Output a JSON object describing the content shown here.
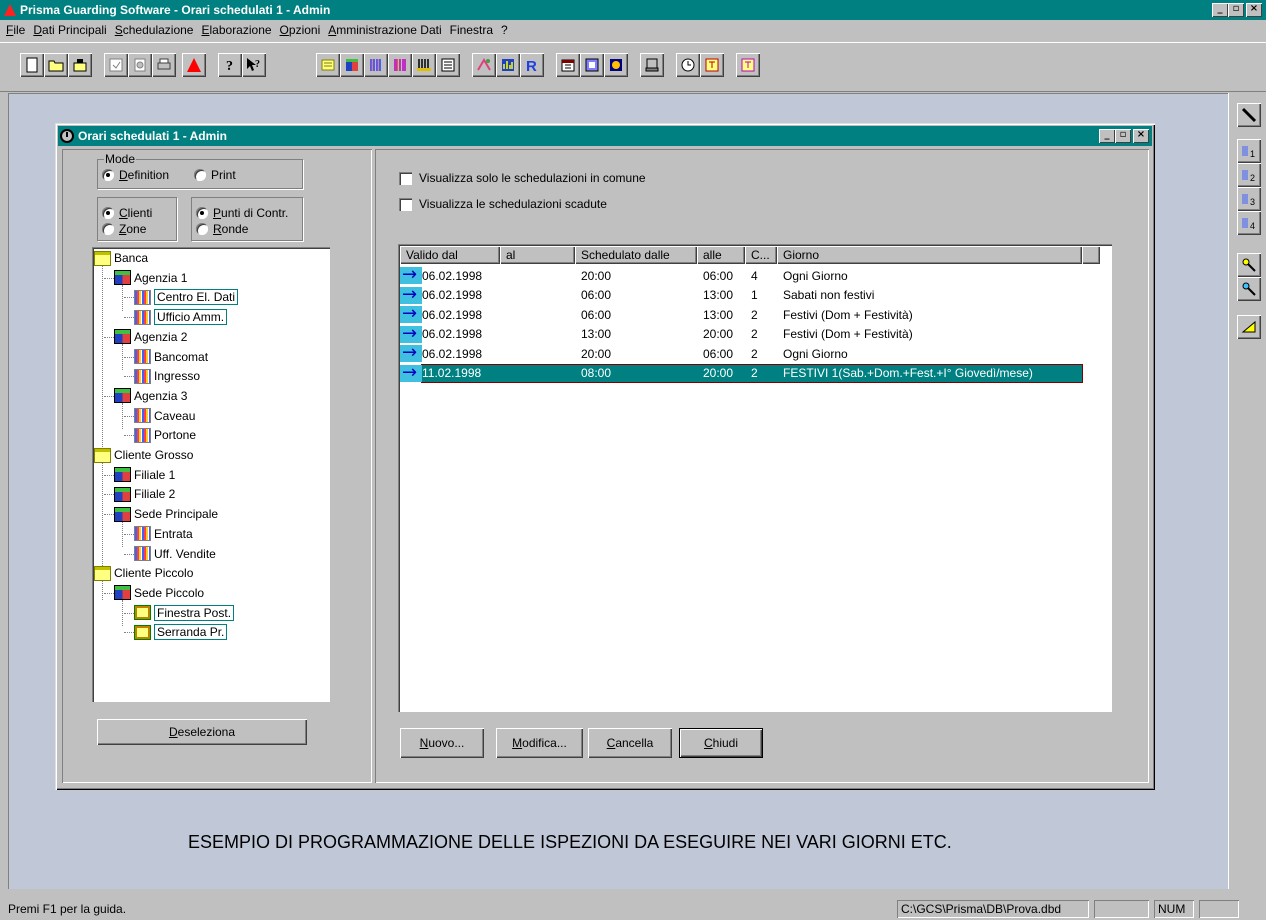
{
  "app": {
    "title": "Prisma Guarding Software - Orari schedulati 1 - Admin",
    "window_controls": {
      "minimize": "_",
      "maximize": "▫",
      "close": "×"
    }
  },
  "menu": [
    "File",
    "Dati Principali",
    "Schedulazione",
    "Elaborazione",
    "Opzioni",
    "Amministrazione Dati",
    "Finestra",
    "?"
  ],
  "toolbar_icons": [
    "new-file-icon",
    "open-folder-icon",
    "save-icon",
    "properties-icon",
    "preview-icon",
    "print-icon",
    "alarm-triangle-icon",
    "help-icon",
    "context-help-icon",
    "clients-icon",
    "buildings-icon",
    "points-icon",
    "barcode-icon",
    "columns-icon",
    "reader-icon",
    "operators-icon",
    "data-icon",
    "report-icon",
    "calendar-icon",
    "scheduling-icon",
    "log-icon",
    "terminal-icon",
    "clock-icon",
    "timing-icon",
    "timing-alt-icon"
  ],
  "right_toolbar_icons": [
    "wand-icon",
    "points-1-icon",
    "points-2-icon",
    "points-3-icon",
    "points-4-icon",
    "key-yellow-icon",
    "key-blue-icon",
    "ruler-icon"
  ],
  "child": {
    "title": "Orari schedulati 1 - Admin",
    "mode": {
      "label": "Mode",
      "definition": "Definition",
      "print": "Print",
      "selected": "Definition"
    },
    "filter_a": {
      "clienti": "Clienti",
      "zone": "Zone",
      "selected": "Clienti"
    },
    "filter_b": {
      "punti": "Punti di Contr.",
      "ronde": "Ronde",
      "selected": "Punti di Contr."
    },
    "tree": [
      {
        "label": "Banca",
        "type": "client",
        "level": 0
      },
      {
        "label": "Agenzia 1",
        "type": "building",
        "level": 1
      },
      {
        "label": "Centro El. Dati",
        "type": "point",
        "level": 2,
        "selected": true
      },
      {
        "label": "Ufficio Amm.",
        "type": "point",
        "level": 2,
        "selected": true
      },
      {
        "label": "Agenzia 2",
        "type": "building",
        "level": 1
      },
      {
        "label": "Bancomat",
        "type": "point",
        "level": 2
      },
      {
        "label": "Ingresso",
        "type": "point",
        "level": 2
      },
      {
        "label": "Agenzia 3",
        "type": "building",
        "level": 1
      },
      {
        "label": "Caveau",
        "type": "point",
        "level": 2
      },
      {
        "label": "Portone",
        "type": "point",
        "level": 2
      },
      {
        "label": "Cliente Grosso",
        "type": "client",
        "level": 0
      },
      {
        "label": "Filiale 1",
        "type": "building",
        "level": 1
      },
      {
        "label": "Filiale 2",
        "type": "building",
        "level": 1
      },
      {
        "label": "Sede Principale",
        "type": "building",
        "level": 1
      },
      {
        "label": "Entrata",
        "type": "point",
        "level": 2
      },
      {
        "label": "Uff. Vendite",
        "type": "point",
        "level": 2
      },
      {
        "label": "Cliente Piccolo",
        "type": "client",
        "level": 0
      },
      {
        "label": "Sede Piccolo",
        "type": "building",
        "level": 1
      },
      {
        "label": "Finestra Post.",
        "type": "point2",
        "level": 2,
        "selected": true
      },
      {
        "label": "Serranda Pr.",
        "type": "point2",
        "level": 2,
        "selected": true
      }
    ],
    "deseleziona": "Deseleziona",
    "checkbox_common": "Visualizza solo le schedulazioni in comune",
    "checkbox_expired": "Visualizza le schedulazioni scadute",
    "columns": [
      "Valido dal",
      "al",
      "Schedulato dalle",
      "alle",
      "C...",
      "Giorno"
    ],
    "rows": [
      [
        "06.02.1998",
        "",
        "20:00",
        "06:00",
        "4",
        "Ogni Giorno"
      ],
      [
        "06.02.1998",
        "",
        "06:00",
        "13:00",
        "1",
        "Sabati non festivi"
      ],
      [
        "06.02.1998",
        "",
        "06:00",
        "13:00",
        "2",
        "Festivi (Dom + Festività)"
      ],
      [
        "06.02.1998",
        "",
        "13:00",
        "20:00",
        "2",
        "Festivi (Dom + Festività)"
      ],
      [
        "06.02.1998",
        "",
        "20:00",
        "06:00",
        "2",
        "Ogni Giorno"
      ],
      [
        "11.02.1998",
        "",
        "08:00",
        "20:00",
        "2",
        "FESTIVI 1(Sab.+Dom.+Fest.+I° Giovedì/mese)"
      ]
    ],
    "selected_row": 5,
    "buttons": {
      "nuovo": "Nuovo...",
      "modifica": "Modifica...",
      "cancella": "Cancella",
      "chiudi": "Chiudi"
    }
  },
  "caption": "ESEMPIO DI PROGRAMMAZIONE DELLE ISPEZIONI DA ESEGUIRE NEI VARI GIORNI ETC.",
  "status": {
    "help": "Premi F1 per la guida.",
    "path": "C:\\GCS\\Prisma\\DB\\Prova.dbd",
    "num": "NUM"
  },
  "colors": {
    "titlebar": "#008080",
    "face": "#c0c0c0",
    "mdi": "#c0c8d8",
    "selection": "#008080"
  }
}
